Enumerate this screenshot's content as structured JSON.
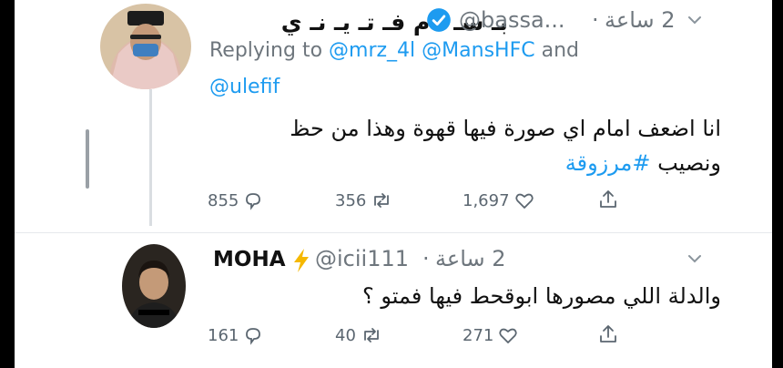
{
  "tweets": [
    {
      "display_name": "بـ سـ ا م فـ تـ يـ نـ ي",
      "handle": "@bassa...",
      "time": "2 ساعة",
      "reply_prefix": "Replying to",
      "reply_mentions_1": "@mrz_4l @MansHFC",
      "reply_and": "and",
      "reply_mentions_2": "@ulefif",
      "text_line1": "انا اضعف امام اي صورة فيها قهوة وهذا من حظ",
      "text_line2_plain": "ونصيب",
      "hashtag": "#مرزوقة",
      "replies": "855",
      "retweets": "356",
      "likes": "1,697"
    },
    {
      "display_name": "MOHA",
      "handle": "@icii111",
      "time": "2 ساعة",
      "text_line1": "والدلة اللي مصورها ابوقحط فيها فمتو ؟",
      "replies": "161",
      "retweets": "40",
      "likes": "271"
    }
  ],
  "icons": {
    "verified": "verified-badge-icon",
    "lightning": "lightning-icon",
    "chevron": "chevron-down-icon",
    "reply": "reply-icon",
    "retweet": "retweet-icon",
    "like": "like-icon",
    "share": "share-icon"
  },
  "colors": {
    "accent": "#1d9bf0",
    "muted": "#6e767d",
    "lightning": "#f5b800"
  }
}
